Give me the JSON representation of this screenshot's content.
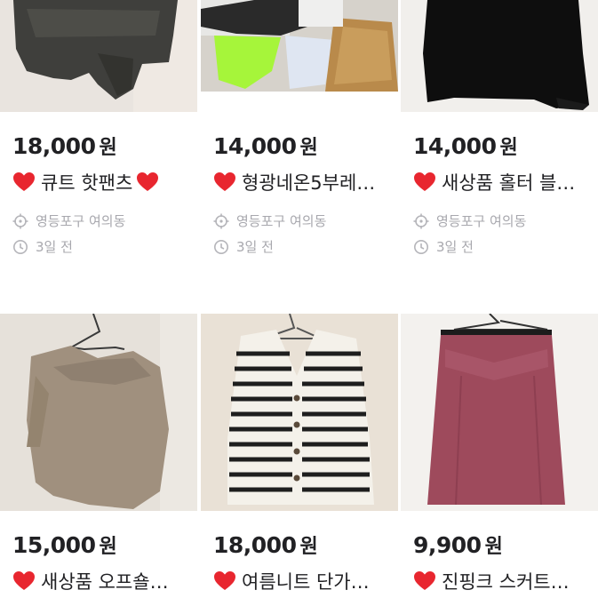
{
  "colors": {
    "price": "#212124",
    "meta": "#a8a8ae",
    "heart": "#e8262f"
  },
  "items": [
    {
      "price": "18,000",
      "currency": "원",
      "heart_icon": "heart-icon",
      "title": "큐트 핫팬츠",
      "title_suffix_heart": true,
      "location": "영등포구 여의동",
      "time": "3일 전"
    },
    {
      "price": "14,000",
      "currency": "원",
      "heart_icon": "heart-icon",
      "title": "형광네온5부레…",
      "title_suffix_heart": false,
      "location": "영등포구 여의동",
      "time": "3일 전"
    },
    {
      "price": "14,000",
      "currency": "원",
      "heart_icon": "heart-icon",
      "title": "새상품 홀터 블…",
      "title_suffix_heart": false,
      "location": "영등포구 여의동",
      "time": "3일 전"
    },
    {
      "price": "15,000",
      "currency": "원",
      "heart_icon": "heart-icon",
      "title": "새상품 오프숄…",
      "title_suffix_heart": false
    },
    {
      "price": "18,000",
      "currency": "원",
      "heart_icon": "heart-icon",
      "title": "여름니트 단가…",
      "title_suffix_heart": false
    },
    {
      "price": "9,900",
      "currency": "원",
      "heart_icon": "heart-icon",
      "title": "진핑크 스커트…",
      "title_suffix_heart": false
    }
  ],
  "icons": {
    "location": "location-target-icon",
    "time": "clock-icon"
  }
}
